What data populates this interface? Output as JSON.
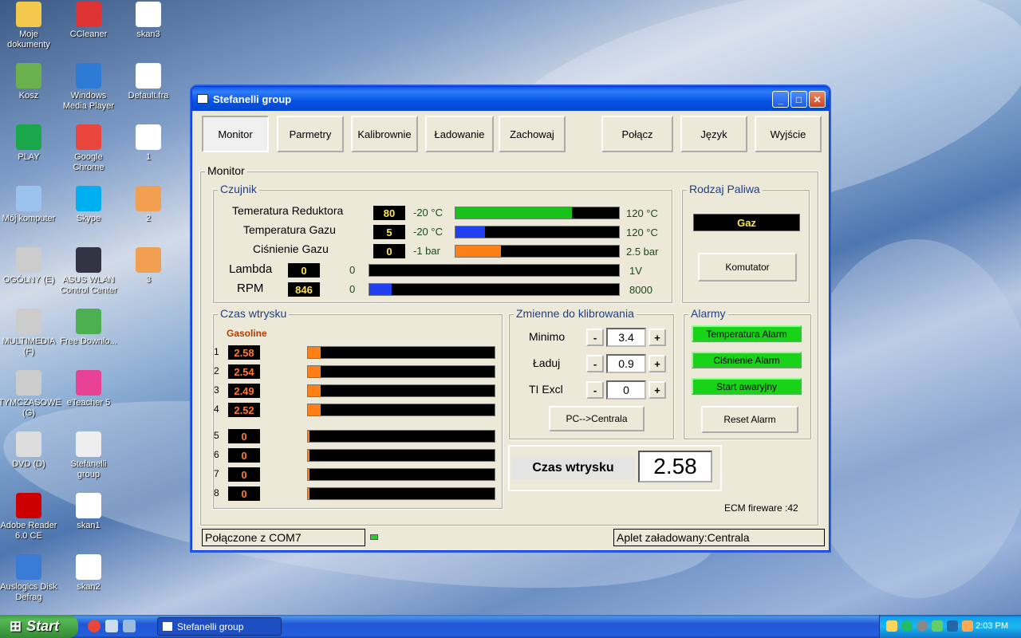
{
  "desktop": {
    "icons": [
      {
        "label": "Moje dokumenty",
        "icon": "folder-icon",
        "color": "#f2c94c"
      },
      {
        "label": "CCleaner",
        "icon": "ccleaner-icon",
        "color": "#d33"
      },
      {
        "label": "skan3",
        "icon": "paint-file-icon",
        "color": "#fff"
      },
      {
        "label": "Kosz",
        "icon": "recycle-bin-icon",
        "color": "#6ab04c"
      },
      {
        "label": "Windows Media Player",
        "icon": "media-player-icon",
        "color": "#2e7bd6"
      },
      {
        "label": "Default.fra",
        "icon": "file-icon",
        "color": "#fff"
      },
      {
        "label": "PLAY",
        "icon": "play-icon",
        "color": "#1aa64b"
      },
      {
        "label": "Google Chrome",
        "icon": "chrome-icon",
        "color": "#e8453c"
      },
      {
        "label": "1",
        "icon": "paint-file-icon",
        "color": "#fff"
      },
      {
        "label": "Mój komputer",
        "icon": "computer-icon",
        "color": "#9cc3ee"
      },
      {
        "label": "Skype",
        "icon": "skype-icon",
        "color": "#00aff0"
      },
      {
        "label": "2",
        "icon": "image-file-icon",
        "color": "#f0a050"
      },
      {
        "label": "OGÓLNY (E)",
        "icon": "drive-icon",
        "color": "#ccc"
      },
      {
        "label": "ASUS WLAN Control Center",
        "icon": "wlan-icon",
        "color": "#334"
      },
      {
        "label": "3",
        "icon": "image-file-icon",
        "color": "#f0a050"
      },
      {
        "label": "MULTIMEDIA (F)",
        "icon": "drive-icon",
        "color": "#ccc"
      },
      {
        "label": "Free Downlo...",
        "icon": "download-icon",
        "color": "#4caf50"
      },
      {
        "label": "TYMCZASOWE (G)",
        "icon": "drive-icon",
        "color": "#ccc"
      },
      {
        "label": "eTeacher 5",
        "icon": "eteacher-icon",
        "color": "#e84393"
      },
      {
        "label": "DVD (D)",
        "icon": "dvd-icon",
        "color": "#ddd"
      },
      {
        "label": "Stefanelli group",
        "icon": "app-icon",
        "color": "#eee"
      },
      {
        "label": "Adobe Reader 6.0 CE",
        "icon": "adobe-icon",
        "color": "#c00"
      },
      {
        "label": "skan1",
        "icon": "paint-file-icon",
        "color": "#fff"
      },
      {
        "label": "Auslogics Disk Defrag",
        "icon": "defrag-icon",
        "color": "#3a7bd5"
      },
      {
        "label": "skan2",
        "icon": "paint-file-icon",
        "color": "#fff"
      }
    ]
  },
  "window": {
    "title": "Stefanelli group",
    "nav": [
      "Monitor",
      "Parmetry",
      "Kalibrownie",
      "Ładowanie",
      "Zachowaj",
      "Połącz",
      "Język",
      "Wyjście"
    ],
    "monitor_label": "Monitor",
    "czujnik": {
      "title": "Czujnik",
      "rows": [
        {
          "label": "Temeratura Reduktora",
          "value": "80",
          "min": "-20 °C",
          "max": "120 °C",
          "fill": 0.71,
          "color": "#19c219"
        },
        {
          "label": "Temperatura Gazu",
          "value": "5",
          "min": "-20 °C",
          "max": "120 °C",
          "fill": 0.18,
          "color": "#1f3ff0"
        },
        {
          "label": "Ciśnienie Gazu",
          "value": "0",
          "min": "-1 bar",
          "max": "2.5 bar",
          "fill": 0.28,
          "color": "#ff7f17"
        },
        {
          "label": "Lambda",
          "value": "0",
          "min": "0",
          "max": "1V",
          "fill": 0,
          "color": "#19c219"
        },
        {
          "label": "RPM",
          "value": "846",
          "min": "0",
          "max": "8000",
          "fill": 0.09,
          "color": "#1f3ff0"
        }
      ]
    },
    "rodzaj": {
      "title": "Rodzaj Paliwa",
      "value": "Gaz",
      "button": "Komutator"
    },
    "czas": {
      "title": "Czas wtrysku",
      "subtitle": "Gasoline",
      "rows": [
        {
          "n": "1",
          "value": "2.58",
          "fill": 0.07
        },
        {
          "n": "2",
          "value": "2.54",
          "fill": 0.07
        },
        {
          "n": "3",
          "value": "2.49",
          "fill": 0.07
        },
        {
          "n": "4",
          "value": "2.52",
          "fill": 0.07
        },
        {
          "n": "5",
          "value": "0",
          "fill": 0.01
        },
        {
          "n": "6",
          "value": "0",
          "fill": 0.01
        },
        {
          "n": "7",
          "value": "0",
          "fill": 0.01
        },
        {
          "n": "8",
          "value": "0",
          "fill": 0.01
        }
      ]
    },
    "zmienne": {
      "title": "Zmienne do klibrowania",
      "rows": [
        {
          "label": "Minimo",
          "value": "3.4"
        },
        {
          "label": "Ładuj",
          "value": "0.9"
        },
        {
          "label": "TI Excl",
          "value": "0"
        }
      ],
      "minus": "-",
      "plus": "+",
      "button": "PC-->Centrala"
    },
    "alarmy": {
      "title": "Alarmy",
      "items": [
        "Temperatura Alarm",
        "Ciśnienie Alarm",
        "Start awaryjny"
      ],
      "reset": "Reset Alarm"
    },
    "czas_big": {
      "label": "Czas wtrysku",
      "value": "2.58"
    },
    "firmware": "ECM fireware :42",
    "status_left": "Połączone z COM7",
    "status_right": "Aplet załadowany:Centrala"
  },
  "taskbar": {
    "start": "Start",
    "task": "Stefanelli group",
    "time": "2:03 PM"
  }
}
